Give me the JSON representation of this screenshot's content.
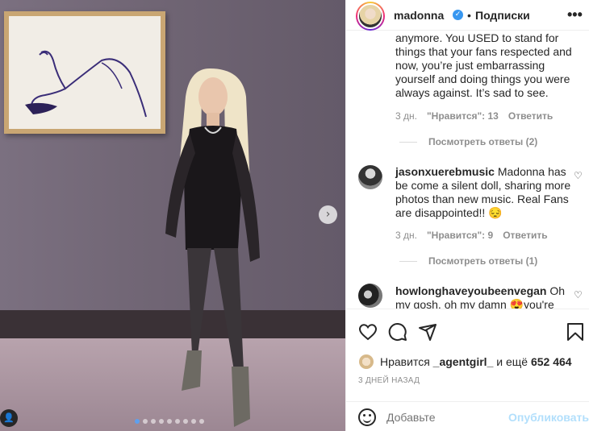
{
  "header": {
    "username": "madonna",
    "separator": "•",
    "follow_label": "Подписки",
    "verified_glyph": "✓",
    "more_icon": "•••"
  },
  "comments": [
    {
      "text": "anymore. You USED to stand for things that your fans respected and now, you’re just embarrassing yourself and doing things you were always against. It’s sad to see.",
      "time": "3 дн.",
      "likes": "\"Нравится\": 13",
      "reply": "Ответить",
      "view_replies": "Посмотреть ответы (2)"
    },
    {
      "username": "jasonxuerebmusic",
      "text": "Madonna has be come a silent doll, sharing more photos than new music. Real Fans are disappointed!! 😔",
      "time": "3 дн.",
      "likes": "\"Нравится\": 9",
      "reply": "Ответить",
      "view_replies": "Посмотреть ответы (1)"
    },
    {
      "username": "howlonghaveyoubeenvegan",
      "text": "Oh my gosh, oh my damn 😍you're"
    }
  ],
  "likes": {
    "prefix": "Нравится",
    "user": "_agentgirl_",
    "middle": "и ещё",
    "count": "652 464"
  },
  "date": "3 ДНЕЙ НАЗАД",
  "add_comment": {
    "placeholder": "Добавьте",
    "publish": "Опубликовать"
  },
  "photo": {
    "next_arrow": "›",
    "carousel_total": 9,
    "carousel_active": 0
  },
  "colors": {
    "accent": "#0095f6",
    "publish_disabled": "#b2dffc",
    "secondary_text": "#8e8e8e",
    "verified": "#3897f0"
  },
  "icons": [
    "heart-icon",
    "comment-icon",
    "share-icon",
    "bookmark-icon",
    "emoji-icon",
    "verified-icon",
    "more-icon",
    "next-arrow-icon",
    "user-tag-icon"
  ]
}
